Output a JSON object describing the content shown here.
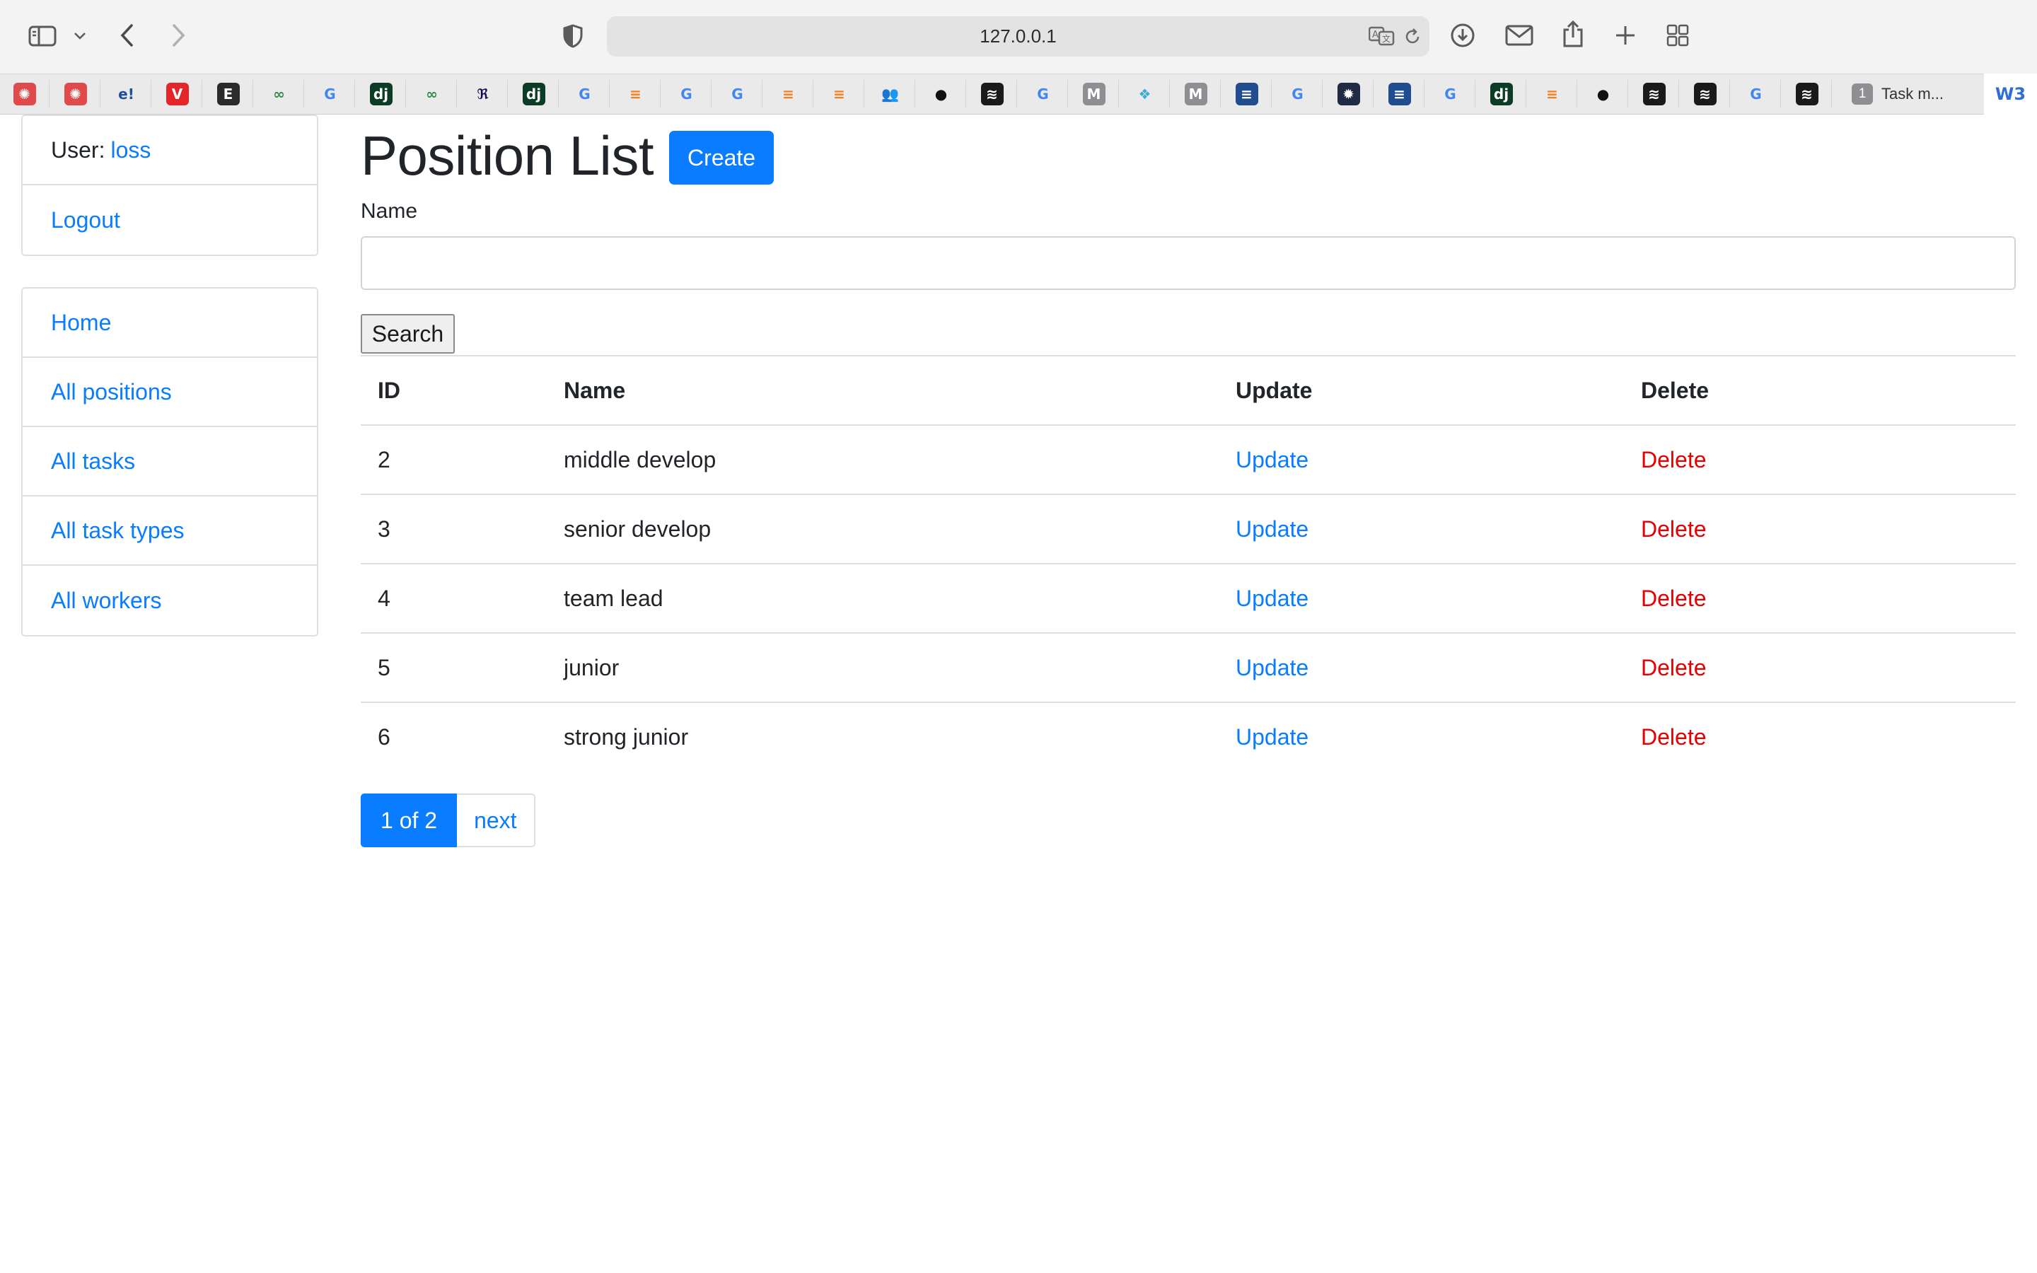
{
  "browser": {
    "url": "127.0.0.1",
    "favorites": [
      {
        "icon": "openai-icon",
        "glyph": "✺",
        "bg": "#e04a4a"
      },
      {
        "icon": "openai-icon",
        "glyph": "✺",
        "bg": "#e04a4a"
      },
      {
        "icon": "e-exclaim-icon",
        "glyph": "e!",
        "bg": "#ebeaea",
        "fg": "#1d4f9c"
      },
      {
        "icon": "v-red-icon",
        "glyph": "V",
        "bg": "#e6252a"
      },
      {
        "icon": "e-box-icon",
        "glyph": "E",
        "bg": "#2b2b2b"
      },
      {
        "icon": "geeksforgeeks-icon",
        "glyph": "∞",
        "bg": "#ebeaea",
        "fg": "#2f8d46"
      },
      {
        "icon": "google-icon",
        "glyph": "G",
        "bg": "#ebeaea",
        "fg": "#4285f4"
      },
      {
        "icon": "django-icon",
        "glyph": "dj",
        "bg": "#0c3c26"
      },
      {
        "icon": "geeksforgeeks-icon",
        "glyph": "∞",
        "bg": "#ebeaea",
        "fg": "#2f8d46"
      },
      {
        "icon": "pandas-icon",
        "glyph": "ℜ",
        "bg": "#ebeaea",
        "fg": "#130654"
      },
      {
        "icon": "django-icon",
        "glyph": "dj",
        "bg": "#0c3c26"
      },
      {
        "icon": "google-icon",
        "glyph": "G",
        "bg": "#ebeaea",
        "fg": "#4285f4"
      },
      {
        "icon": "stackoverflow-icon",
        "glyph": "≡",
        "bg": "#ebeaea",
        "fg": "#f48024"
      },
      {
        "icon": "google-icon",
        "glyph": "G",
        "bg": "#ebeaea",
        "fg": "#4285f4"
      },
      {
        "icon": "google-icon",
        "glyph": "G",
        "bg": "#ebeaea",
        "fg": "#4285f4"
      },
      {
        "icon": "stackoverflow-icon",
        "glyph": "≡",
        "bg": "#ebeaea",
        "fg": "#f48024"
      },
      {
        "icon": "stackoverflow-icon",
        "glyph": "≡",
        "bg": "#ebeaea",
        "fg": "#f48024"
      },
      {
        "icon": "people-icon",
        "glyph": "👥",
        "bg": "#ebeaea",
        "fg": "#2f6fd1"
      },
      {
        "icon": "github-icon",
        "glyph": "●",
        "bg": "#ebeaea",
        "fg": "#111111"
      },
      {
        "icon": "black-logo-icon",
        "glyph": "≋",
        "bg": "#1a1a1a"
      },
      {
        "icon": "google-icon",
        "glyph": "G",
        "bg": "#ebeaea",
        "fg": "#4285f4"
      },
      {
        "icon": "m-gray-icon",
        "glyph": "M",
        "bg": "#8e8e93"
      },
      {
        "icon": "cube-icon",
        "glyph": "❖",
        "bg": "#ebeaea",
        "fg": "#3fa9d8"
      },
      {
        "icon": "m-gray-icon",
        "glyph": "M",
        "bg": "#8e8e93"
      },
      {
        "icon": "stack-blue-icon",
        "glyph": "≡",
        "bg": "#1f4d8f"
      },
      {
        "icon": "google-icon",
        "glyph": "G",
        "bg": "#ebeaea",
        "fg": "#4285f4"
      },
      {
        "icon": "gear-dark-icon",
        "glyph": "✹",
        "bg": "#1f2a44"
      },
      {
        "icon": "stack-blue-icon",
        "glyph": "≡",
        "bg": "#1f4d8f"
      },
      {
        "icon": "google-icon",
        "glyph": "G",
        "bg": "#ebeaea",
        "fg": "#4285f4"
      },
      {
        "icon": "django-icon",
        "glyph": "dj",
        "bg": "#0c3c26"
      },
      {
        "icon": "stackoverflow-icon",
        "glyph": "≡",
        "bg": "#ebeaea",
        "fg": "#f48024"
      },
      {
        "icon": "github-icon",
        "glyph": "●",
        "bg": "#ebeaea",
        "fg": "#111111"
      },
      {
        "icon": "black-logo-icon",
        "glyph": "≋",
        "bg": "#1a1a1a"
      },
      {
        "icon": "black-logo-icon",
        "glyph": "≋",
        "bg": "#1a1a1a"
      },
      {
        "icon": "google-icon",
        "glyph": "G",
        "bg": "#ebeaea",
        "fg": "#4285f4"
      },
      {
        "icon": "black-logo-icon",
        "glyph": "≋",
        "bg": "#1a1a1a"
      }
    ],
    "tab": {
      "badge": "1",
      "label": "Task m..."
    },
    "w3_label": "W3"
  },
  "sidebar": {
    "user_label": "User:",
    "username": "loss",
    "logout": "Logout",
    "nav": [
      "Home",
      "All positions",
      "All tasks",
      "All task types",
      "All workers"
    ]
  },
  "main": {
    "title": "Position List",
    "create_label": "Create",
    "filter_label": "Name",
    "search_value": "",
    "search_label": "Search"
  },
  "table": {
    "headers": {
      "id": "ID",
      "name": "Name",
      "update": "Update",
      "delete": "Delete"
    },
    "rows": [
      {
        "id": "2",
        "name": "middle develop",
        "update": "Update",
        "delete": "Delete"
      },
      {
        "id": "3",
        "name": "senior develop",
        "update": "Update",
        "delete": "Delete"
      },
      {
        "id": "4",
        "name": "team lead",
        "update": "Update",
        "delete": "Delete"
      },
      {
        "id": "5",
        "name": "junior",
        "update": "Update",
        "delete": "Delete"
      },
      {
        "id": "6",
        "name": "strong junior",
        "update": "Update",
        "delete": "Delete"
      }
    ]
  },
  "pagination": {
    "current": "1 of 2",
    "next": "next"
  },
  "colors": {
    "link": "#0a7cff",
    "danger": "#e60000",
    "primary": "#0a7cff"
  }
}
